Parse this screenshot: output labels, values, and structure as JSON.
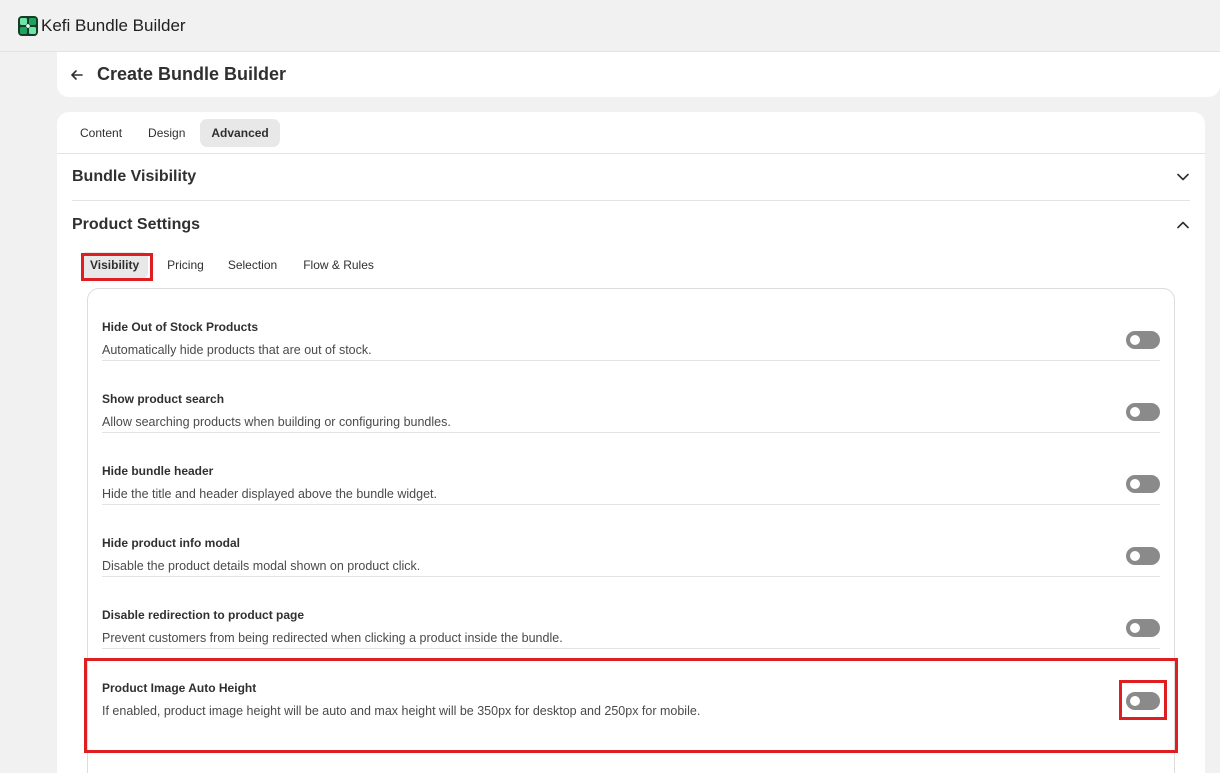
{
  "app": {
    "title": "Kefi Bundle Builder",
    "logo_icon": "kefi-logo-icon"
  },
  "header": {
    "back_icon": "arrow-left-icon",
    "title": "Create Bundle Builder"
  },
  "tabs": [
    {
      "label": "Content",
      "active": false
    },
    {
      "label": "Design",
      "active": false
    },
    {
      "label": "Advanced",
      "active": true
    }
  ],
  "sections": {
    "bundle_visibility": {
      "title": "Bundle Visibility",
      "expanded": false
    },
    "product_settings": {
      "title": "Product Settings",
      "expanded": true
    }
  },
  "subtabs": [
    {
      "label": "Visibility",
      "active": true
    },
    {
      "label": "Pricing",
      "active": false
    },
    {
      "label": "Selection",
      "active": false
    },
    {
      "label": "Flow & Rules",
      "active": false
    }
  ],
  "settings": [
    {
      "title": "Hide Out of Stock Products",
      "description": "Automatically hide products that are out of stock.",
      "enabled": false
    },
    {
      "title": "Show product search",
      "description": "Allow searching products when building or configuring bundles.",
      "enabled": false
    },
    {
      "title": "Hide bundle header",
      "description": "Hide the title and header displayed above the bundle widget.",
      "enabled": false
    },
    {
      "title": "Hide product info modal",
      "description": "Disable the product details modal shown on product click.",
      "enabled": false
    },
    {
      "title": "Disable redirection to product page",
      "description": "Prevent customers from being redirected when clicking a product inside the bundle.",
      "enabled": false
    },
    {
      "title": "Product Image Auto Height",
      "description": "If enabled, product image height will be auto and max height will be 350px for desktop and 250px for mobile.",
      "enabled": false
    }
  ],
  "colors": {
    "highlight": "#e01e22",
    "toggle_off": "#8a8a8a",
    "brand_green": "#1fa35a"
  }
}
